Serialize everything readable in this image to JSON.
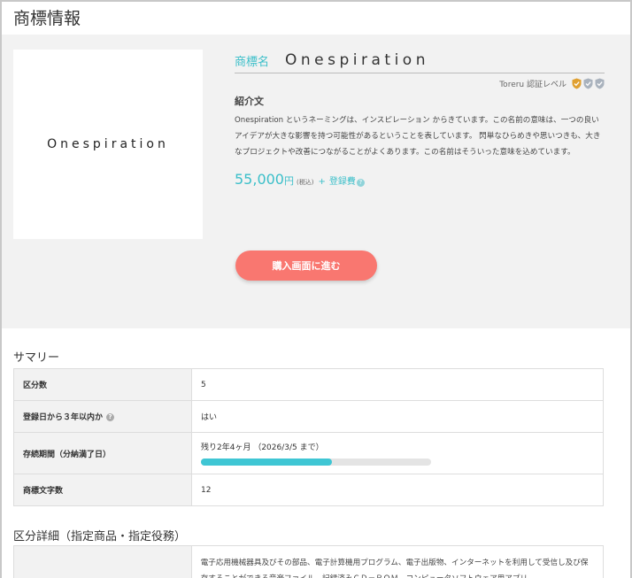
{
  "page": {
    "title": "商標情報"
  },
  "trademark": {
    "logo_text": "Onespiration",
    "name_label": "商標名",
    "name": "Onespiration",
    "level_label": "Toreru 認証レベル",
    "level_icons": [
      "shield-check-gold",
      "shield-check-gray",
      "shield-check-gray"
    ],
    "intro_heading": "紹介文",
    "intro_text": "Onespiration というネーミングは、インスピレーション からきています。この名前の意味は、一つの良いアイデアが大きな影響を持つ可能性があるということを表しています。 閃単なひらめきや思いつきも、大きなプロジェクトや改善につながることがよくあります。この名前はそういった意味を込めています。",
    "price": "55,000",
    "price_unit": "円",
    "price_tax": "(税込)",
    "price_plus": "+",
    "price_fee": "登録費",
    "buy_button": "購入画面に進む"
  },
  "summary": {
    "title": "サマリー",
    "rows": [
      {
        "key": "区分数",
        "value": "5"
      },
      {
        "key": "登録日から３年以内か",
        "value": "はい"
      },
      {
        "key": "存続期間（分納満了日）",
        "value": "残り2年4ヶ月 （2026/3/5 まで）"
      },
      {
        "key": "商標文字数",
        "value": "12"
      }
    ],
    "progress": 0.57
  },
  "detail": {
    "title": "区分詳細（指定商品・指定役務）",
    "text": "電子応用機械器具及びその部品、電子計算機用プログラム、電子出版物、インターネットを利用して受信し及び保存することができる音楽ファイル、記録済みＣＤ－ＲＯＭ、コンピュータソフトウェア用アプリ"
  },
  "colors": {
    "accent": "#3bbfc9",
    "button": "#f97770",
    "gold": "#e0a030",
    "gray": "#a9b2bd"
  }
}
